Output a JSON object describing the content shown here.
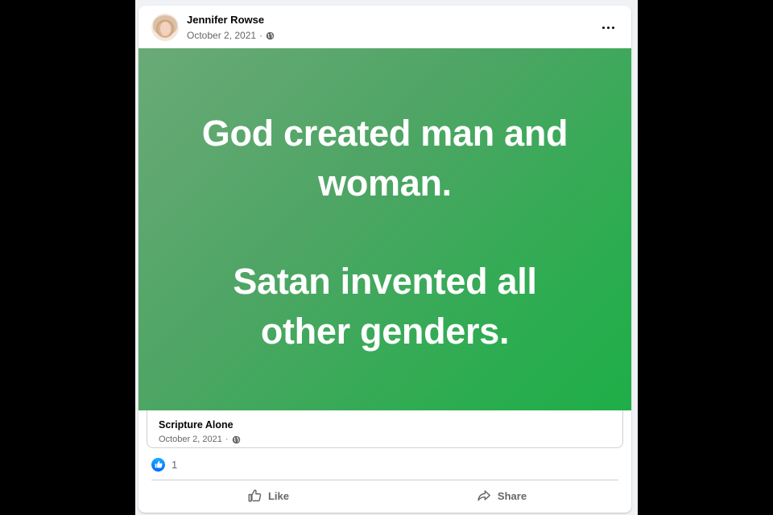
{
  "post": {
    "author": "Jennifer Rowse",
    "date": "October 2, 2021",
    "date_separator": "·",
    "privacy_icon": "globe-icon",
    "menu_icon": "more-options-icon",
    "image": {
      "background_colors": [
        "#6aaa78",
        "#1eae47"
      ],
      "line1": "God created man and",
      "line2": "woman.",
      "line3": "Satan invented all",
      "line4": "other genders."
    },
    "shared_from": {
      "title": "Scripture Alone",
      "date": "October 2, 2021",
      "date_separator": "·"
    },
    "reactions": {
      "icon": "like-reaction-icon",
      "count": "1"
    },
    "actions": {
      "like_label": "Like",
      "share_label": "Share"
    }
  },
  "colors": {
    "accent": "#0866ff",
    "secondary_text": "#65676b",
    "primary_text": "#050505"
  }
}
